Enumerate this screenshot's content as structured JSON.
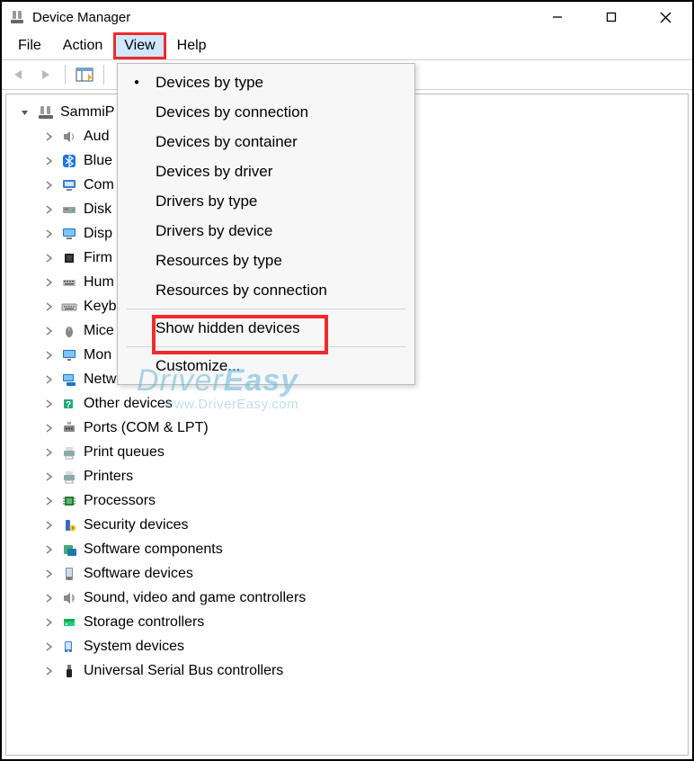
{
  "window": {
    "title": "Device Manager"
  },
  "menubar": {
    "file": "File",
    "action": "Action",
    "view": "View",
    "help": "Help"
  },
  "view_menu": {
    "items": [
      "Devices by type",
      "Devices by connection",
      "Devices by container",
      "Devices by driver",
      "Drivers by type",
      "Drivers by device",
      "Resources by type",
      "Resources by connection"
    ],
    "show_hidden": "Show hidden devices",
    "customize": "Customize..."
  },
  "tree": {
    "root": "SammiP",
    "nodes": [
      "Aud",
      "Blue",
      "Com",
      "Disk",
      "Disp",
      "Firm",
      "Hum",
      "Keyb",
      "Mice",
      "Mon",
      "Netw",
      "Other devices",
      "Ports (COM & LPT)",
      "Print queues",
      "Printers",
      "Processors",
      "Security devices",
      "Software components",
      "Software devices",
      "Sound, video and game controllers",
      "Storage controllers",
      "System devices",
      "Universal Serial Bus controllers"
    ]
  },
  "watermark": {
    "brand_a": "Driver",
    "brand_b": "Easy",
    "url": "www.DriverEasy.com"
  }
}
